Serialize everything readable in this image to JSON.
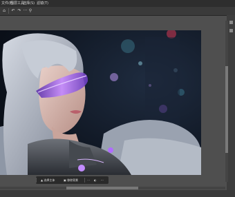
{
  "menubar": {
    "items": [
      "文件(F)",
      "图层工具",
      "选择(S)",
      "滤镜(T)"
    ]
  },
  "toolbar": {
    "buttons": [
      {
        "icon": "home-icon",
        "glyph": "⌂"
      },
      {
        "icon": "undo-icon",
        "glyph": "↶"
      },
      {
        "icon": "redo-icon",
        "glyph": "↷"
      },
      {
        "icon": "more-icon",
        "glyph": "···"
      },
      {
        "icon": "zoom-icon",
        "glyph": "⚲"
      }
    ]
  },
  "contextbar": {
    "items": [
      {
        "icon": "select-subject-icon",
        "label": "选择主体"
      },
      {
        "icon": "remove-background-icon",
        "label": "移除背景"
      }
    ],
    "tools": [
      "⋯",
      "◐",
      "···"
    ]
  },
  "colors": {
    "accent_purple": "#b06cff",
    "background": "#4f4f4f",
    "panel": "#3a3a3a"
  }
}
